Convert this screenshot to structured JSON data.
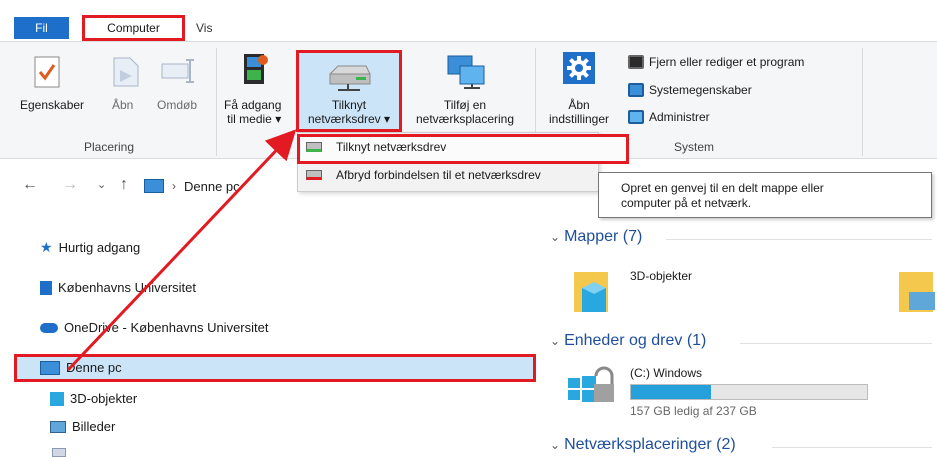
{
  "tabs": {
    "fil": "Fil",
    "computer": "Computer",
    "vis": "Vis"
  },
  "ribbon": {
    "groups": {
      "placering": "Placering",
      "system": "System"
    },
    "egenskaber": "Egenskaber",
    "aabn": "Åbn",
    "omdoeb": "Omdøb",
    "faa_adgang_1": "Få adgang",
    "faa_adgang_2": "til medie ▾",
    "tilknyt_1": "Tilknyt",
    "tilknyt_2": "netværksdrev ▾",
    "tilfoej_1": "Tilføj en",
    "tilfoej_2": "netværksplacering",
    "aabn_indst_1": "Åbn",
    "aabn_indst_2": "indstillinger",
    "fjern": "Fjern eller rediger et program",
    "systemegenskaber": "Systemegenskaber",
    "administrer": "Administrer"
  },
  "dropdown": {
    "item1": "Tilknyt netværksdrev",
    "item2": "Afbryd forbindelsen til et netværksdrev"
  },
  "tooltip": {
    "line1": "Opret en genvej til en delt mappe eller",
    "line2": "computer på et netværk."
  },
  "address": {
    "location": "Denne pc"
  },
  "nav": {
    "hurtig": "Hurtig adgang",
    "ku": "Københavns Universitet",
    "onedrive": "OneDrive - Københavns Universitet",
    "denne_pc": "Denne pc",
    "objekter": "3D-objekter",
    "billeder": "Billeder"
  },
  "content": {
    "mapper": "Mapper (7)",
    "objekter": "3D-objekter",
    "enheder": "Enheder og drev (1)",
    "drive_name": "(C:) Windows",
    "drive_free": "157 GB ledig af 237 GB",
    "drive_used_fraction": 0.34,
    "netvaerk": "Netværksplaceringer (2)"
  },
  "colors": {
    "accent": "#1e6fc9",
    "highlight": "#e21b23",
    "selection": "#cce4f7",
    "drive_fill": "#26a0da"
  }
}
